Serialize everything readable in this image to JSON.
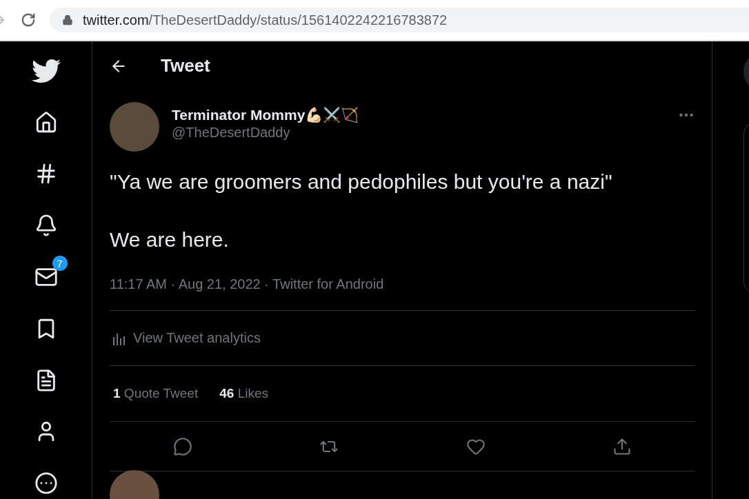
{
  "browser": {
    "url_host": "twitter.com",
    "url_path": "/TheDesertDaddy/status/1561402242216783872"
  },
  "sidebar": {
    "items": [
      {
        "kind": "home"
      },
      {
        "kind": "explore"
      },
      {
        "kind": "notifications"
      },
      {
        "kind": "messages",
        "badge": "7"
      },
      {
        "kind": "bookmarks"
      },
      {
        "kind": "lists"
      },
      {
        "kind": "profile"
      },
      {
        "kind": "more"
      }
    ]
  },
  "header": {
    "title": "Tweet"
  },
  "tweet": {
    "author": "Terminator Mommy💪🏻⚔️🏹",
    "handle": "@TheDesertDaddy",
    "paragraphs": [
      "\"Ya we are groomers and pedophiles but you're a nazi\"",
      "We are here."
    ],
    "meta": "11:17 AM · Aug 21, 2022 · Twitter for Android",
    "analytics": "View Tweet analytics",
    "stats": [
      {
        "count": "1",
        "label": "Quote Tweet"
      },
      {
        "count": "46",
        "label": "Likes"
      }
    ],
    "actions": [
      {
        "kind": "reply"
      },
      {
        "kind": "retweet"
      },
      {
        "kind": "like"
      },
      {
        "kind": "share"
      }
    ]
  }
}
